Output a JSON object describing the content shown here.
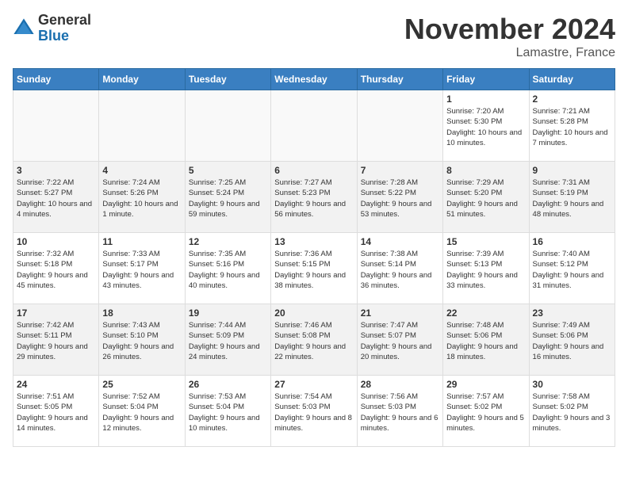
{
  "header": {
    "logo": {
      "general": "General",
      "blue": "Blue"
    },
    "title": "November 2024",
    "location": "Lamastre, France"
  },
  "weekdays": [
    "Sunday",
    "Monday",
    "Tuesday",
    "Wednesday",
    "Thursday",
    "Friday",
    "Saturday"
  ],
  "weeks": [
    [
      {
        "day": null,
        "info": null
      },
      {
        "day": null,
        "info": null
      },
      {
        "day": null,
        "info": null
      },
      {
        "day": null,
        "info": null
      },
      {
        "day": null,
        "info": null
      },
      {
        "day": "1",
        "info": "Sunrise: 7:20 AM\nSunset: 5:30 PM\nDaylight: 10 hours and 10 minutes."
      },
      {
        "day": "2",
        "info": "Sunrise: 7:21 AM\nSunset: 5:28 PM\nDaylight: 10 hours and 7 minutes."
      }
    ],
    [
      {
        "day": "3",
        "info": "Sunrise: 7:22 AM\nSunset: 5:27 PM\nDaylight: 10 hours and 4 minutes."
      },
      {
        "day": "4",
        "info": "Sunrise: 7:24 AM\nSunset: 5:26 PM\nDaylight: 10 hours and 1 minute."
      },
      {
        "day": "5",
        "info": "Sunrise: 7:25 AM\nSunset: 5:24 PM\nDaylight: 9 hours and 59 minutes."
      },
      {
        "day": "6",
        "info": "Sunrise: 7:27 AM\nSunset: 5:23 PM\nDaylight: 9 hours and 56 minutes."
      },
      {
        "day": "7",
        "info": "Sunrise: 7:28 AM\nSunset: 5:22 PM\nDaylight: 9 hours and 53 minutes."
      },
      {
        "day": "8",
        "info": "Sunrise: 7:29 AM\nSunset: 5:20 PM\nDaylight: 9 hours and 51 minutes."
      },
      {
        "day": "9",
        "info": "Sunrise: 7:31 AM\nSunset: 5:19 PM\nDaylight: 9 hours and 48 minutes."
      }
    ],
    [
      {
        "day": "10",
        "info": "Sunrise: 7:32 AM\nSunset: 5:18 PM\nDaylight: 9 hours and 45 minutes."
      },
      {
        "day": "11",
        "info": "Sunrise: 7:33 AM\nSunset: 5:17 PM\nDaylight: 9 hours and 43 minutes."
      },
      {
        "day": "12",
        "info": "Sunrise: 7:35 AM\nSunset: 5:16 PM\nDaylight: 9 hours and 40 minutes."
      },
      {
        "day": "13",
        "info": "Sunrise: 7:36 AM\nSunset: 5:15 PM\nDaylight: 9 hours and 38 minutes."
      },
      {
        "day": "14",
        "info": "Sunrise: 7:38 AM\nSunset: 5:14 PM\nDaylight: 9 hours and 36 minutes."
      },
      {
        "day": "15",
        "info": "Sunrise: 7:39 AM\nSunset: 5:13 PM\nDaylight: 9 hours and 33 minutes."
      },
      {
        "day": "16",
        "info": "Sunrise: 7:40 AM\nSunset: 5:12 PM\nDaylight: 9 hours and 31 minutes."
      }
    ],
    [
      {
        "day": "17",
        "info": "Sunrise: 7:42 AM\nSunset: 5:11 PM\nDaylight: 9 hours and 29 minutes."
      },
      {
        "day": "18",
        "info": "Sunrise: 7:43 AM\nSunset: 5:10 PM\nDaylight: 9 hours and 26 minutes."
      },
      {
        "day": "19",
        "info": "Sunrise: 7:44 AM\nSunset: 5:09 PM\nDaylight: 9 hours and 24 minutes."
      },
      {
        "day": "20",
        "info": "Sunrise: 7:46 AM\nSunset: 5:08 PM\nDaylight: 9 hours and 22 minutes."
      },
      {
        "day": "21",
        "info": "Sunrise: 7:47 AM\nSunset: 5:07 PM\nDaylight: 9 hours and 20 minutes."
      },
      {
        "day": "22",
        "info": "Sunrise: 7:48 AM\nSunset: 5:06 PM\nDaylight: 9 hours and 18 minutes."
      },
      {
        "day": "23",
        "info": "Sunrise: 7:49 AM\nSunset: 5:06 PM\nDaylight: 9 hours and 16 minutes."
      }
    ],
    [
      {
        "day": "24",
        "info": "Sunrise: 7:51 AM\nSunset: 5:05 PM\nDaylight: 9 hours and 14 minutes."
      },
      {
        "day": "25",
        "info": "Sunrise: 7:52 AM\nSunset: 5:04 PM\nDaylight: 9 hours and 12 minutes."
      },
      {
        "day": "26",
        "info": "Sunrise: 7:53 AM\nSunset: 5:04 PM\nDaylight: 9 hours and 10 minutes."
      },
      {
        "day": "27",
        "info": "Sunrise: 7:54 AM\nSunset: 5:03 PM\nDaylight: 9 hours and 8 minutes."
      },
      {
        "day": "28",
        "info": "Sunrise: 7:56 AM\nSunset: 5:03 PM\nDaylight: 9 hours and 6 minutes."
      },
      {
        "day": "29",
        "info": "Sunrise: 7:57 AM\nSunset: 5:02 PM\nDaylight: 9 hours and 5 minutes."
      },
      {
        "day": "30",
        "info": "Sunrise: 7:58 AM\nSunset: 5:02 PM\nDaylight: 9 hours and 3 minutes."
      }
    ]
  ]
}
